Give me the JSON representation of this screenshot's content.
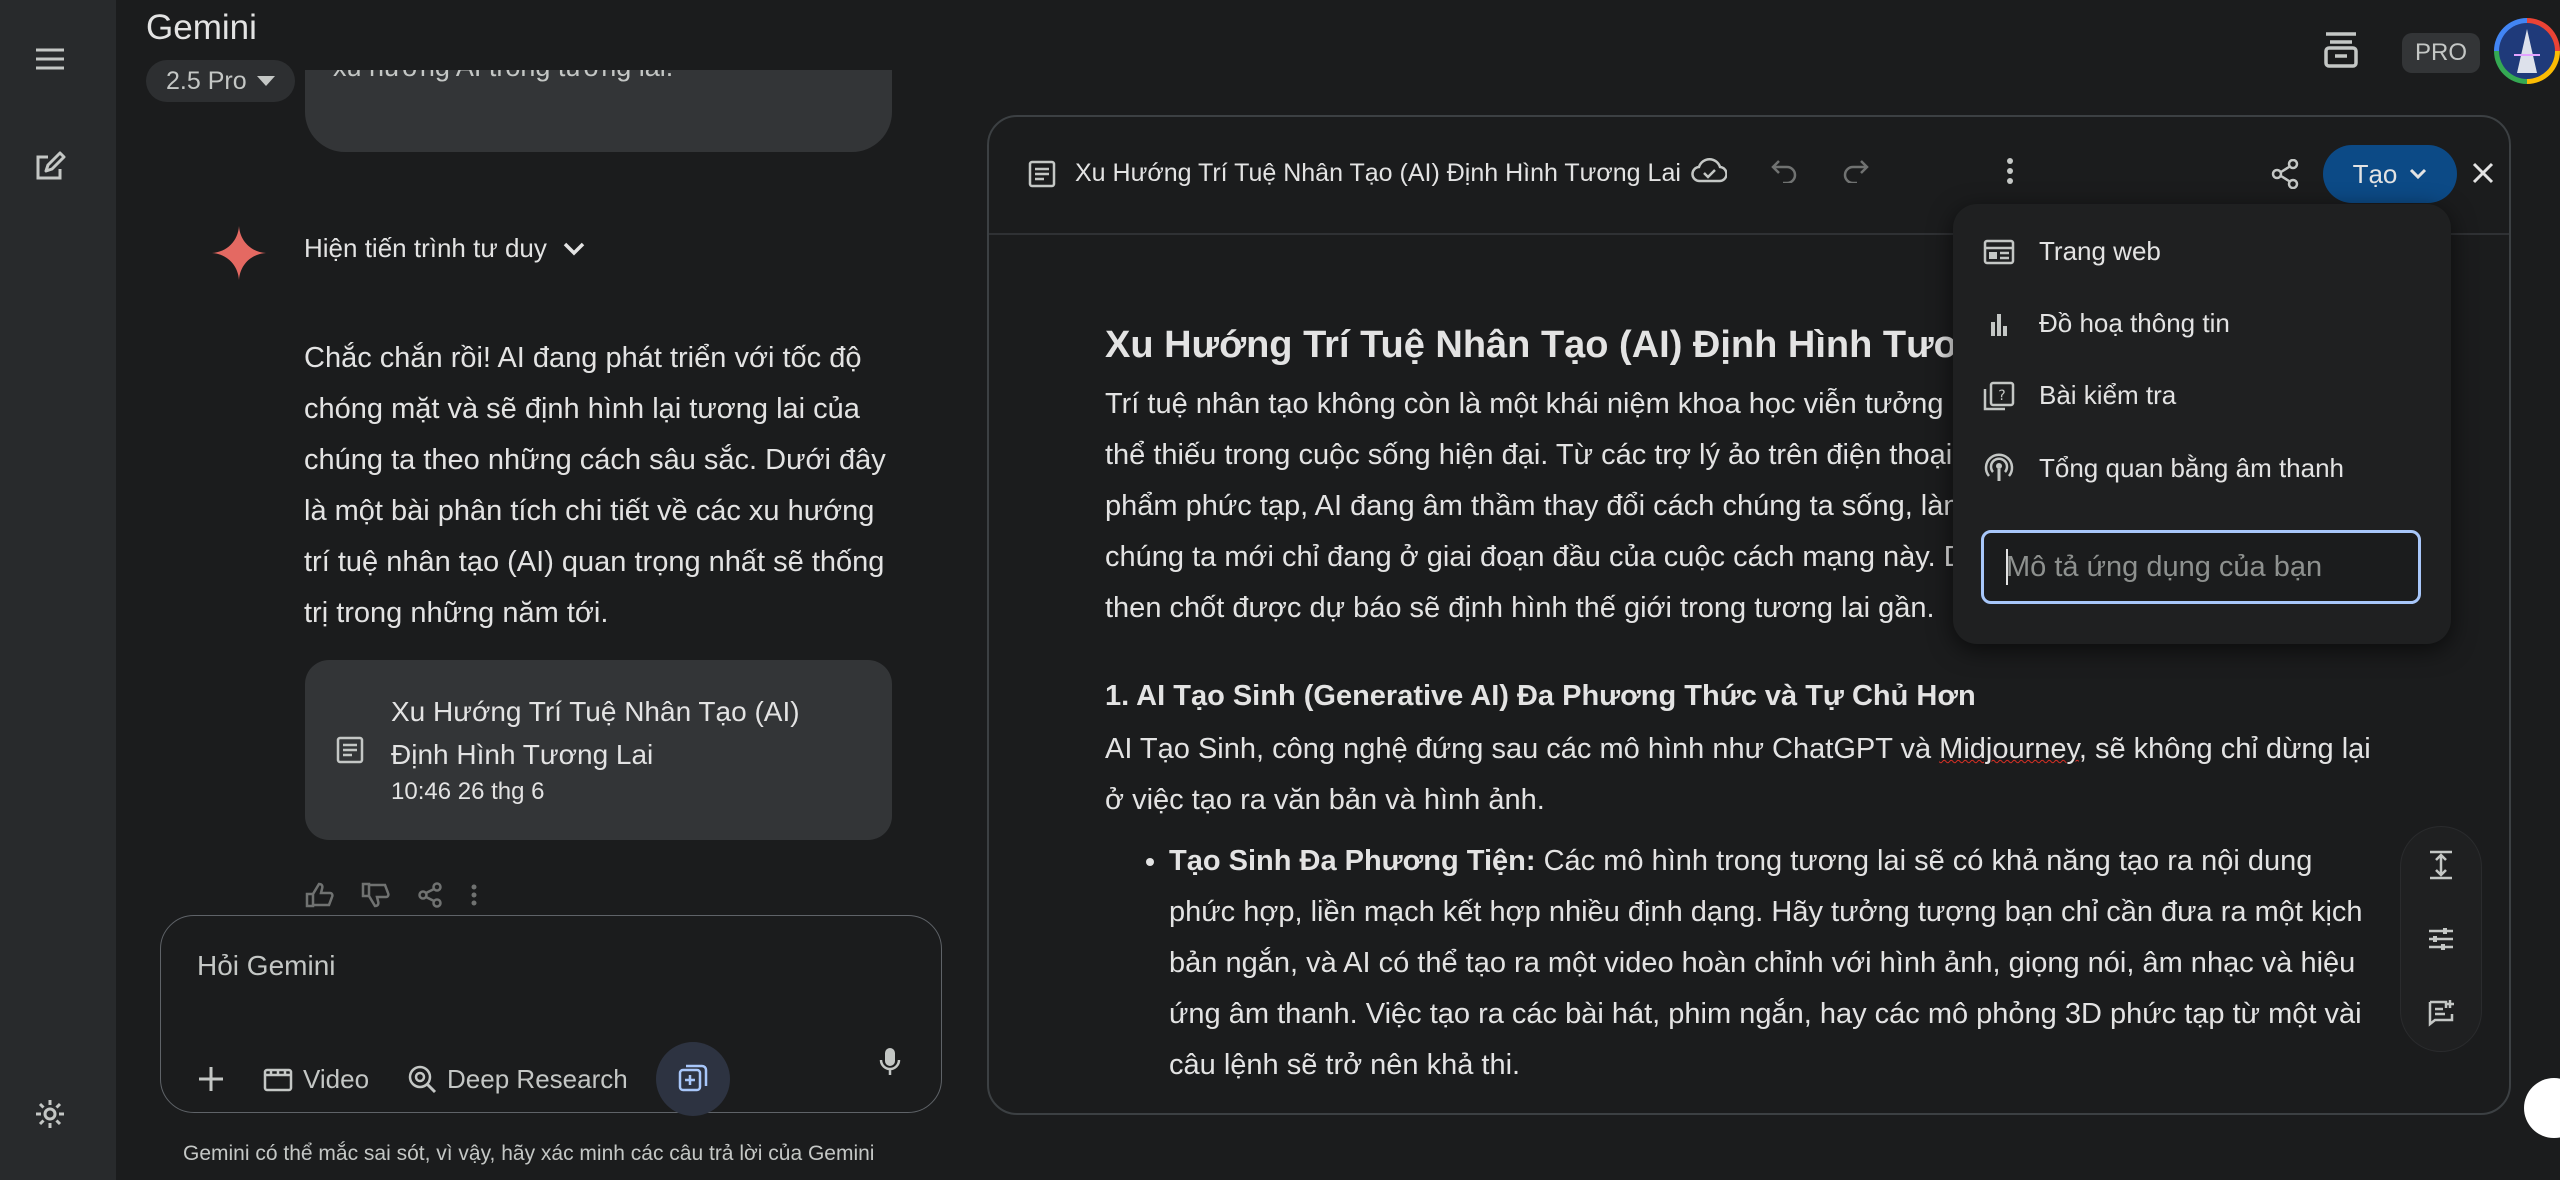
{
  "app": {
    "title": "Gemini",
    "model_chip": "2.5 Pro",
    "pro_badge": "PRO"
  },
  "rail": {
    "menu_icon": "menu-icon",
    "new_chat_icon": "edit-icon",
    "settings_icon": "settings-icon"
  },
  "chat": {
    "previous_user_fragment": "xu hướng AI trong tương lai.",
    "thinking_label": "Hiện tiến trình tư duy",
    "answer": "Chắc chắn rồi! AI đang phát triển với tốc độ chóng mặt và sẽ định hình lại tương lai của chúng ta theo những cách sâu sắc. Dưới đây là một bài phân tích chi tiết về các xu hướng trí tuệ nhân tạo (AI) quan trọng nhất sẽ thống trị trong những năm tới.",
    "doc_card": {
      "title": "Xu Hướng Trí Tuệ Nhân Tạo (AI) Định Hình Tương Lai",
      "time": "10:46 26 thg 6"
    }
  },
  "input": {
    "placeholder": "Hỏi Gemini",
    "tools": {
      "video": "Video",
      "deep_research": "Deep Research"
    }
  },
  "disclaimer": "Gemini có thể mắc sai sót, vì vậy, hãy xác minh các câu trả lời của Gemini",
  "canvas": {
    "title": "Xu Hướng Trí Tuệ Nhân Tạo (AI) Định Hình Tương Lai",
    "create_label": "Tạo",
    "doc": {
      "h1": "Xu Hướng Trí Tuệ Nhân Tạo (AI) Định Hình Tương Lai",
      "intro": "Trí tuệ nhân tạo không còn là một khái niệm khoa học viễn tưởng mà đã trở thành một phần không thể thiếu trong cuộc sống hiện đại. Từ các trợ lý ảo trên điện thoại đến các hệ thống thiết kế sản phẩm phức tạp, AI đang âm thầm thay đổi cách chúng ta sống, làm việc và giao tiếp. Tuy nhiên, chúng ta mới chỉ đang ở giai đoạn đầu của cuộc cách mạng này. Dưới đây là những xu hướng AI then chốt được dự báo sẽ định hình thế giới trong tương lai gần.",
      "h2": "1. AI Tạo Sinh (Generative AI) Đa Phương Thức và Tự Chủ Hơn",
      "p2_a": "AI Tạo Sinh, công nghệ đứng sau các mô hình như ChatGPT và ",
      "p2_link": "Midjourney",
      "p2_b": ", sẽ không chỉ dừng lại ở việc tạo ra văn bản và hình ảnh.",
      "bullet_bold": "Tạo Sinh Đa Phương Tiện:",
      "bullet_text": " Các mô hình trong tương lai sẽ có khả năng tạo ra nội dung phức hợp, liền mạch kết hợp nhiều định dạng. Hãy tưởng tượng bạn chỉ cần đưa ra một kịch bản ngắn, và AI có thể tạo ra một video hoàn chỉnh với hình ảnh, giọng nói, âm nhạc và hiệu ứng âm thanh. Việc tạo ra các bài hát, phim ngắn, hay các mô phỏng 3D phức tạp từ một vài câu lệnh sẽ trở nên khả thi."
    }
  },
  "menu": {
    "items": [
      {
        "label": "Trang web",
        "icon": "web-page-icon"
      },
      {
        "label": "Đồ hoạ thông tin",
        "icon": "bar-chart-icon"
      },
      {
        "label": "Bài kiểm tra",
        "icon": "quiz-icon"
      },
      {
        "label": "Tổng quan bằng âm thanh",
        "icon": "podcast-icon"
      }
    ],
    "input_placeholder": "Mô tả ứng dụng của bạn"
  }
}
